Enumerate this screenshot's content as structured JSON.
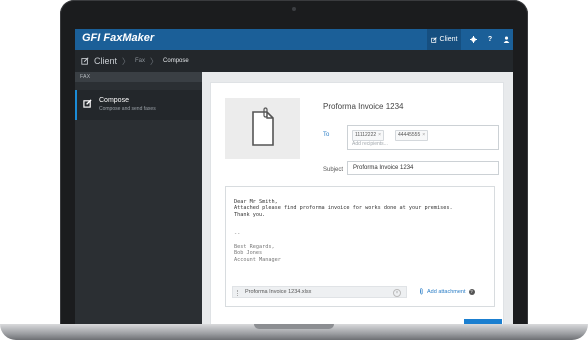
{
  "app": {
    "brand_prefix": "GFI",
    "brand_main": "FaxMaker"
  },
  "topnav": {
    "client_label": "Client",
    "gear_icon": "gear-icon",
    "help_label": "?",
    "user_icon": "user-icon"
  },
  "breadcrumb": {
    "client": "Client",
    "fax": "Fax",
    "compose": "Compose"
  },
  "sidebar": {
    "section": "FAX",
    "item_title": "Compose",
    "item_subtitle": "Compose and send faxes"
  },
  "compose": {
    "doc_title": "Proforma Invoice 1234",
    "to_label": "To",
    "recipients": [
      "11112222",
      "44445555"
    ],
    "add_recipients_placeholder": "Add recipients...",
    "subject_label": "Subject",
    "subject_value": "Proforma Invoice 1234",
    "body_lines": [
      "Dear Mr Smith,",
      "Attached please find proforma invoice for works done at your premises.",
      "Thank you."
    ],
    "signature_lines": [
      "--",
      "Best Regards,",
      "Bob Jones",
      "Account Manager"
    ],
    "attachment_name": "Proforma Invoice 1234.xlsx",
    "add_attachment_label": "Add attachment"
  },
  "colors": {
    "brand_blue": "#1b5f98",
    "accent_blue": "#2a7dc6",
    "sidebar_dark": "#2b2f33"
  }
}
